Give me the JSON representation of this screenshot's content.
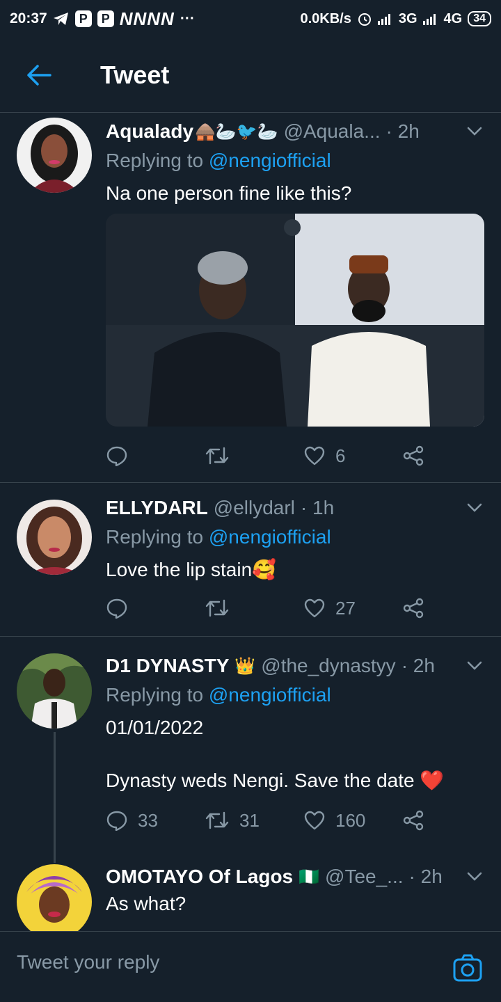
{
  "status_bar": {
    "time": "20:37",
    "badges": [
      "P",
      "P"
    ],
    "notif_text": "NNNN",
    "dots": "···",
    "speed": "0.0KB/s",
    "network1": "3G",
    "network2": "4G",
    "battery": "34"
  },
  "header": {
    "title": "Tweet"
  },
  "tweets": [
    {
      "name": "Aqualady",
      "name_decor": "🛖🦢🐦🦢",
      "handle": "@Aquala...",
      "time": "· 2h",
      "replying_prefix": "Replying to ",
      "replying_to": "@nengiofficial",
      "text": "Na one person fine like this?",
      "replies": "",
      "retweets": "",
      "likes": "6"
    },
    {
      "name": "ELLYDARL",
      "handle": "@ellydarl",
      "time": "· 1h",
      "replying_prefix": "Replying to ",
      "replying_to": "@nengiofficial",
      "text": "Love the lip stain🥰",
      "replies": "",
      "retweets": "",
      "likes": "27"
    },
    {
      "name": "D1 DYNASTY",
      "name_decor": "👑",
      "handle": "@the_dynastyy",
      "time": "· 2h",
      "replying_prefix": "Replying to ",
      "replying_to": "@nengiofficial",
      "text": "01/01/2022\n\nDynasty weds Nengi. Save the date ❤️",
      "replies": "33",
      "retweets": "31",
      "likes": "160"
    },
    {
      "name": "OMOTAYO Of Lagos",
      "name_decor": "🇳🇬",
      "handle": "@Tee_...",
      "time": "· 2h",
      "text": "As what?"
    }
  ],
  "reply_bar": {
    "placeholder": "Tweet your reply"
  },
  "colors": {
    "background": "#15202b",
    "accent": "#1da1f2",
    "secondary_text": "#8899a6",
    "divider": "#38444d"
  }
}
